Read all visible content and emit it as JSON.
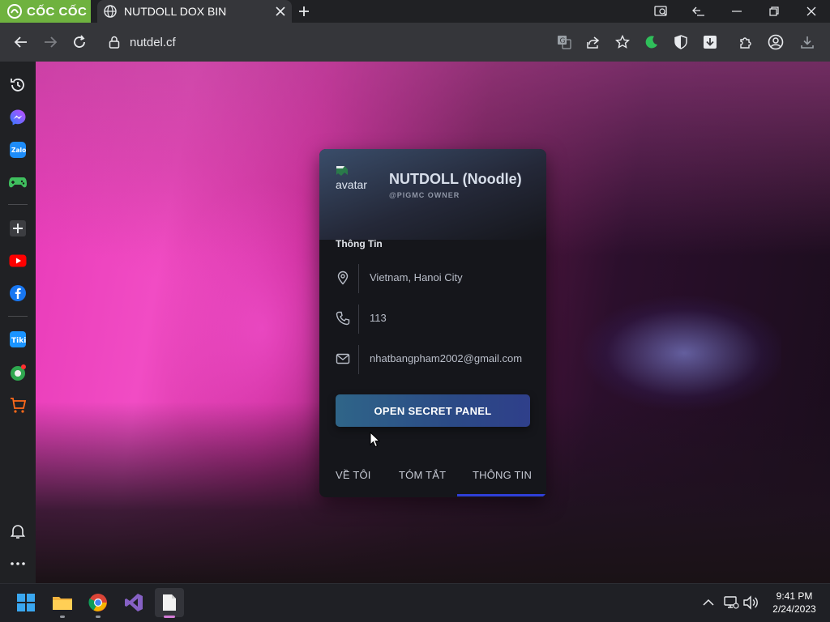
{
  "browser": {
    "brand": "CỐC CỐC",
    "tab": {
      "title": "NUTDOLL DOX BIN",
      "icon": "globe-icon"
    },
    "url": "nutdel.cf"
  },
  "card": {
    "avatar_alt": "avatar",
    "name": "NUTDOLL (Noodle)",
    "role": "@PIGMC OWNER",
    "section_title": "Thông Tin",
    "info": [
      {
        "icon": "location-pin-icon",
        "value": "Vietnam, Hanoi City"
      },
      {
        "icon": "phone-icon",
        "value": "113"
      },
      {
        "icon": "mail-icon",
        "value": "nhatbangpham2002@gmail.com"
      }
    ],
    "button": "OPEN SECRET PANEL",
    "tabs": [
      "VỀ TÔI",
      "TÓM TẮT",
      "THÔNG TIN"
    ],
    "active_tab": "THÔNG TIN"
  },
  "taskbar": {
    "time": "9:41 PM",
    "date": "2/24/2023"
  },
  "colors": {
    "brand_green": "#6fb23f",
    "card_bg": "#15161b",
    "button_gradient_start": "#2f6588",
    "button_gradient_end": "#2f3f8a",
    "active_tab_underline": "#2f3fd8"
  }
}
